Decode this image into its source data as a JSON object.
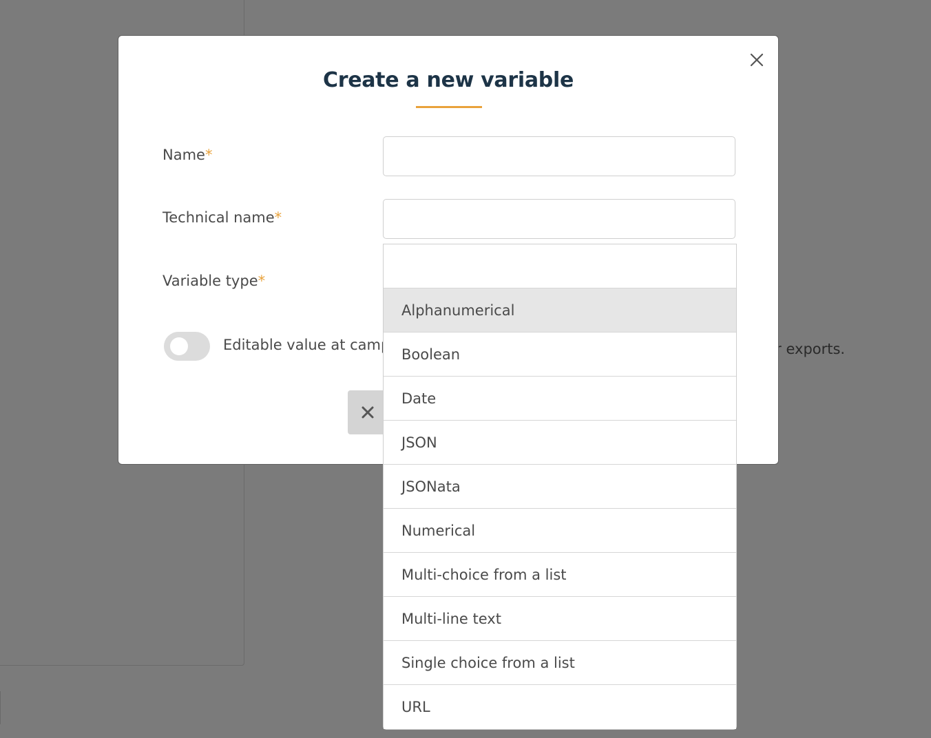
{
  "background": {
    "exports_text": "our exports."
  },
  "modal": {
    "title": "Create a new variable",
    "fields": {
      "name_label": "Name",
      "technical_name_label": "Technical name",
      "variable_type_label": "Variable type",
      "required_marker": "*",
      "name_value": "",
      "technical_name_value": ""
    },
    "toggle": {
      "label": "Editable value at camp",
      "checked": false
    },
    "icons": {
      "close": "close-icon",
      "cancel": "x-icon"
    }
  },
  "dropdown": {
    "search_value": "",
    "options": [
      "Alphanumerical",
      "Boolean",
      "Date",
      "JSON",
      "JSONata",
      "Numerical",
      "Multi-choice from a list",
      "Multi-line text",
      "Single choice from a list",
      "URL"
    ],
    "highlighted": "Alphanumerical"
  },
  "colors": {
    "accent": "#e9a23b",
    "title": "#1d3447",
    "overlay": "#7b7b7b",
    "highlight": "#e6e6e6"
  }
}
